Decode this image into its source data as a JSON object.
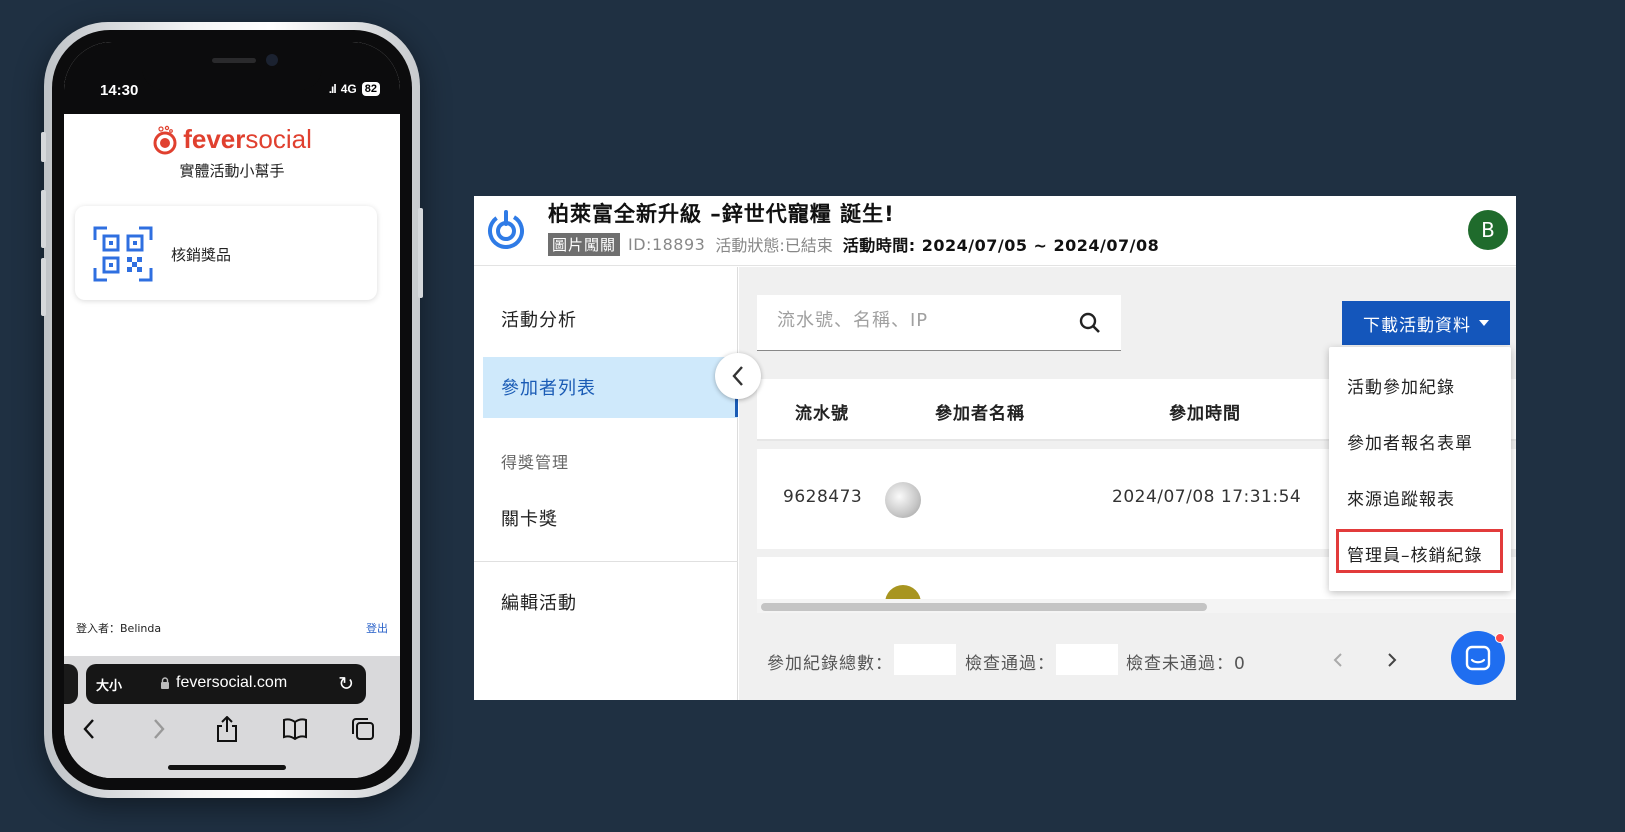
{
  "phone": {
    "status_time": "14:30",
    "network": "4G",
    "battery": "82",
    "brand": {
      "logo_bold": "fever",
      "logo_light": "social",
      "subtitle": "實體活動小幫手"
    },
    "redeem_card_label": "核銷獎品",
    "login_user": "登入者：Belinda",
    "logout_label": "登出",
    "browser": {
      "text_size_label": "大小",
      "url": "feversocial.com"
    }
  },
  "app": {
    "event": {
      "title": "柏萊富全新升級 –鋅世代寵糧 誕生!",
      "type_badge": "圖片闖關",
      "id": "ID:18893",
      "status": "活動狀態:已結束",
      "time": "活動時間: 2024/07/05 ~ 2024/07/08"
    },
    "user_avatar_initial": "B",
    "sidebar": {
      "analysis": "活動分析",
      "participants": "參加者列表",
      "awards_group": "得獎管理",
      "stage_award": "關卡獎",
      "edit_event": "編輯活動"
    },
    "search": {
      "placeholder": "流水號、名稱、IP"
    },
    "download_button_label": "下載活動資料",
    "dropdown": {
      "items": [
        "活動參加紀錄",
        "參加者報名表單",
        "來源追蹤報表",
        "管理員–核銷紀錄"
      ],
      "highlighted": "管理員–核銷紀錄"
    },
    "table": {
      "columns": [
        "流水號",
        "參加者名稱",
        "參加時間"
      ],
      "rows": [
        {
          "serial": "9628473",
          "name": "",
          "time": "2024/07/08 17:31:54"
        },
        {
          "serial": "",
          "name": "",
          "time": ""
        }
      ]
    },
    "footer": {
      "total_label": "參加紀錄總數：",
      "pass_label": "檢查通過：",
      "fail_label": "檢查未通過：0"
    },
    "colors": {
      "primary": "#1456bb",
      "active_bg": "#cfe9fb",
      "highlight_box": "#e23b3b",
      "brand_red": "#e0402f"
    }
  }
}
